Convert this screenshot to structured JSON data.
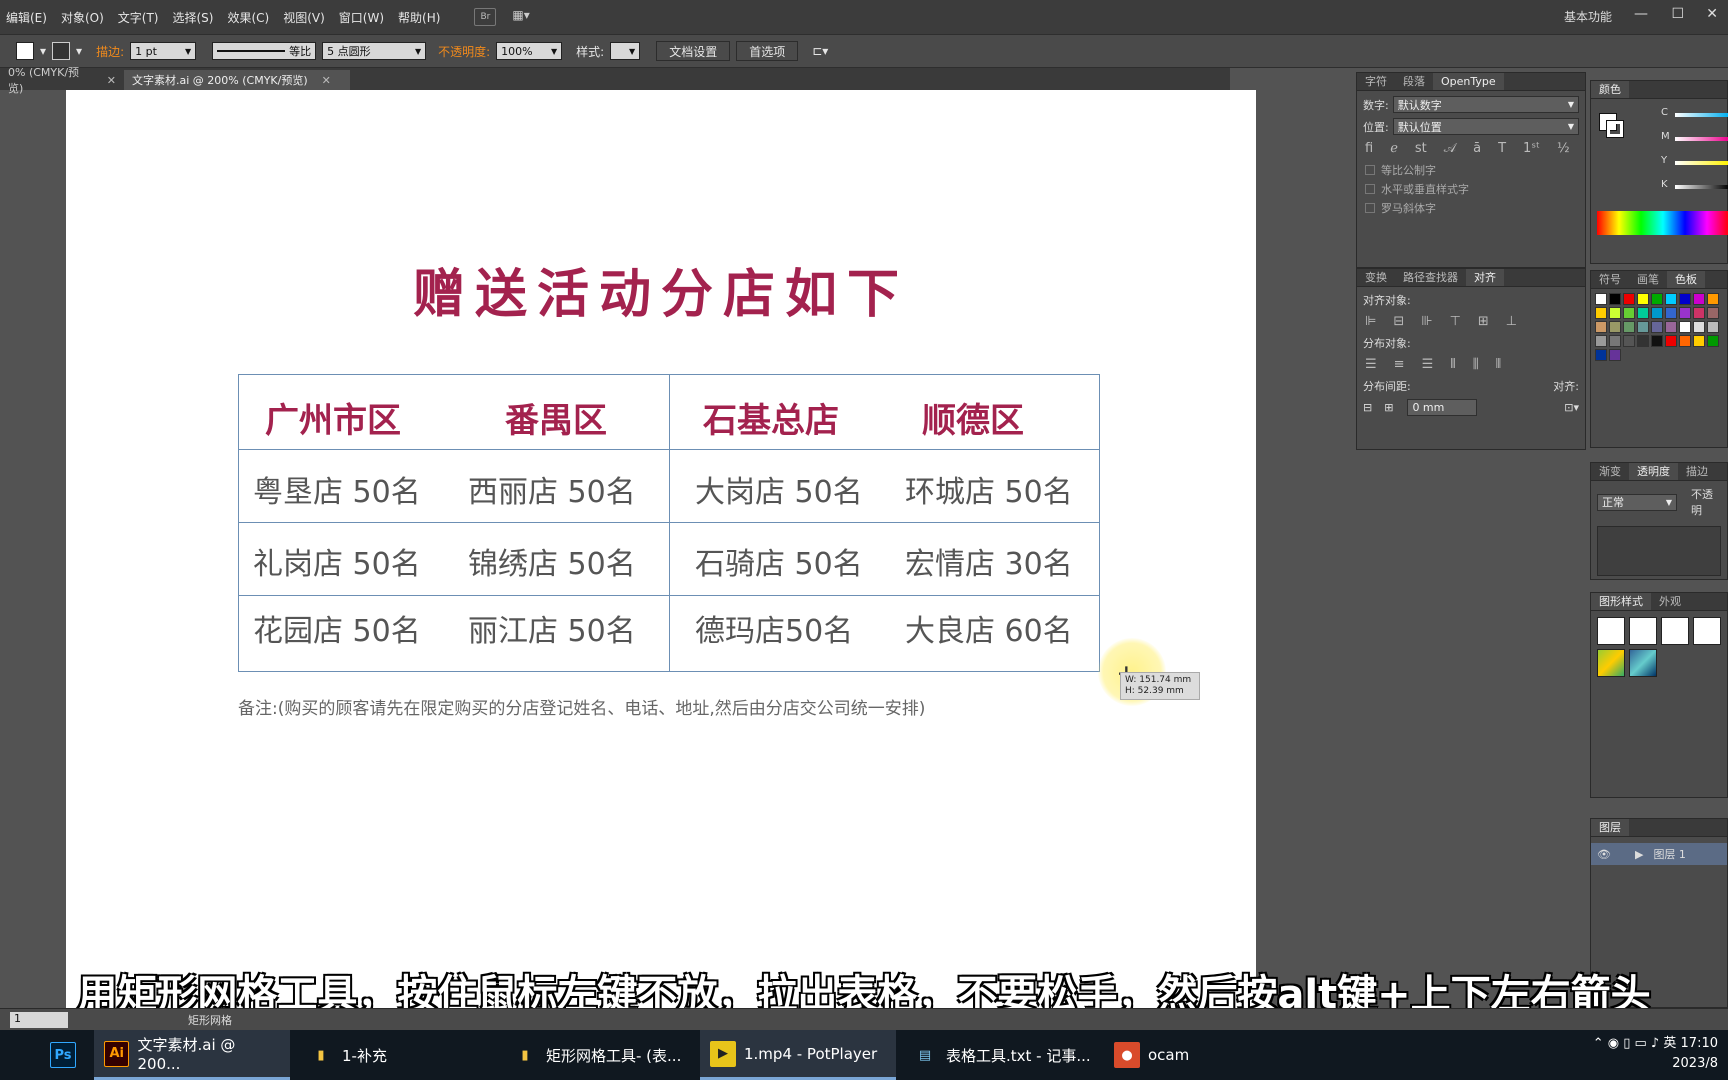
{
  "menu": [
    "编辑(E)",
    "对象(O)",
    "文字(T)",
    "选择(S)",
    "效果(C)",
    "视图(V)",
    "窗口(W)",
    "帮助(H)"
  ],
  "menu_br": "Br",
  "workspace": "基本功能",
  "control": {
    "stroke_label": "描边:",
    "stroke_weight": "1 pt",
    "stroke_style": "等比",
    "brush": "5 点圆形",
    "opacity_label": "不透明度:",
    "opacity": "100%",
    "style_label": "样式:",
    "doc_setup": "文档设置",
    "prefs": "首选项"
  },
  "tabs": [
    "0% (CMYK/预览)",
    "文字素材.ai @ 200% (CMYK/预览)"
  ],
  "artboard": {
    "title": "赠送活动分店如下",
    "headers": [
      "广州市区",
      "番禺区",
      "石基总店",
      "顺德区"
    ],
    "rows": [
      [
        "粤垦店  50名",
        "西丽店  50名",
        "大岗店  50名",
        "环城店 50名"
      ],
      [
        "礼岗店  50名",
        "锦绣店  50名",
        "石骑店  50名",
        "宏情店 30名"
      ],
      [
        "花园店  50名",
        "丽江店  50名",
        "德玛店50名",
        "大良店 60名"
      ]
    ],
    "note": "备注:(购买的顾客请先在限定购买的分店登记姓名、电话、地址,然后由分店交公司统一安排)",
    "tooltip_w": "W: 151.74 mm",
    "tooltip_h": "H: 52.39 mm"
  },
  "char_panel": {
    "tabs": [
      "字符",
      "段落",
      "OpenType"
    ],
    "digits_label": "数字:",
    "digits_value": "默认数字",
    "position_label": "位置:",
    "position_value": "默认位置",
    "checks": [
      "等比公制字",
      "水平或垂直样式字",
      "罗马斜体字"
    ]
  },
  "align_panel": {
    "tabs": [
      "变换",
      "路径查找器",
      "对齐"
    ],
    "align_objects": "对齐对象:",
    "distribute_objects": "分布对象:",
    "distribute_spacing": "分布间距:",
    "spacing_value": "0 mm",
    "align_to": "对齐:"
  },
  "color_panel": {
    "tab": "颜色",
    "channels": [
      "C",
      "M",
      "Y",
      "K"
    ]
  },
  "swatch_panel": {
    "tabs": [
      "符号",
      "画笔",
      "色板"
    ]
  },
  "transparency_panel": {
    "tabs": [
      "渐变",
      "透明度",
      "描边"
    ],
    "mode": "正常",
    "opacity_label": "不透明"
  },
  "graphic_styles": {
    "tabs": [
      "图形样式",
      "外观"
    ]
  },
  "layers": {
    "tab": "图层",
    "layer_name": "图层 1"
  },
  "status": {
    "zoom": "1",
    "tool": "矩形网格"
  },
  "subtitle": "用矩形网格工具，按住鼠标左键不放，拉出表格，不要松手，然后按alt键+上下左右箭头",
  "taskbar": {
    "items": [
      "文字素材.ai @ 200...",
      "1-补充",
      "矩形网格工具- (表...",
      "1.mp4 - PotPlayer",
      "表格工具.txt - 记事...",
      "ocam"
    ],
    "ai_icon": "Ai",
    "ps_icon": "Ps",
    "tray_ime": "英",
    "time": "17:10",
    "date": "2023/8"
  },
  "colors": {
    "accent": "#a3224e",
    "grid": "#6c8fb4",
    "body_text": "#555555"
  }
}
